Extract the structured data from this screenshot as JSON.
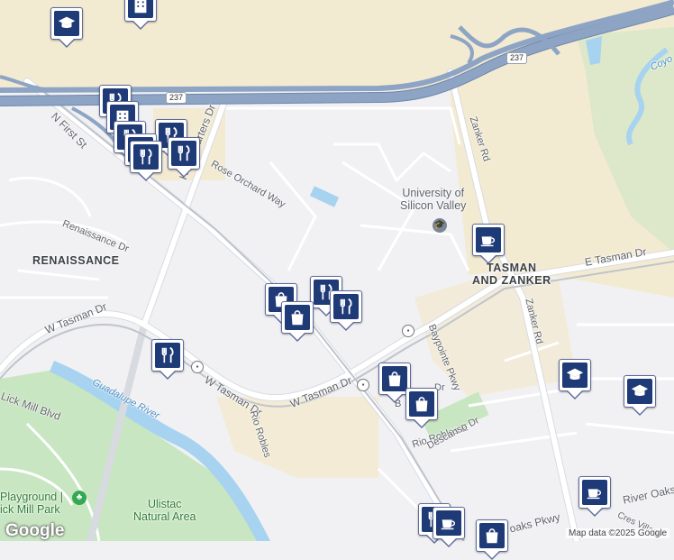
{
  "highway_shield": "237",
  "labels": {
    "north_first_st": "N First St",
    "headquarters_dr": "Headquarters Dr",
    "rose_orchard_way": "Rose Orchard Way",
    "renaissance_dr": "Renaissance Dr",
    "renaissance": "RENAISSANCE",
    "university_line1": "University of",
    "university_line2": "Silicon Valley",
    "zanker_rd_north": "Zanker Rd",
    "zanker_rd_south": "Zanker Rd",
    "e_tasman_dr": "E Tasman Dr",
    "tasman_zanker_line1": "TASMAN",
    "tasman_zanker_line2": "AND ZANKER",
    "w_tasman_dr_west": "W Tasman Dr",
    "w_tasman_dr_mid": "W Tasman Dr",
    "w_tasman_dr_east": "W Tasman Dr",
    "baypointe_pkwy": "Baypointe Pkwy",
    "rio_robles": "Rio Robles",
    "rio_robles_e": "Rio Robles E",
    "descanso_dr": "Descanso Dr",
    "b_dr": "B",
    "b_dr2": "Dr",
    "lick_mill_blvd": "Lick Mill Blvd",
    "guadalupe_river": "Guadalupe River",
    "coyote": "Coyo",
    "playground_park_line1": "Playground |",
    "playground_park_line2": "ick Mill Park",
    "ulistac_line1": "Ulistac",
    "ulistac_line2": "Natural Area",
    "river_oaks": "River Oaks",
    "cres_village": "Cres Village",
    "oaks_pkwy": "oaks Pkwy"
  },
  "pins": [
    {
      "name": "school-marker-1",
      "icon": "graduation-cap-icon"
    },
    {
      "name": "building-marker-top",
      "icon": "building-icon"
    },
    {
      "name": "restaurant-marker-1",
      "icon": "fork-knife-icon"
    },
    {
      "name": "building-marker-2",
      "icon": "building-icon"
    },
    {
      "name": "restaurant-marker-2",
      "icon": "fork-knife-icon"
    },
    {
      "name": "restaurant-marker-3",
      "icon": "fork-knife-icon"
    },
    {
      "name": "restaurant-marker-4",
      "icon": "fork-knife-icon"
    },
    {
      "name": "restaurant-marker-5",
      "icon": "fork-knife-icon"
    },
    {
      "name": "restaurant-marker-6",
      "icon": "fork-knife-icon"
    },
    {
      "name": "shopping-marker-1",
      "icon": "shopping-bag-icon"
    },
    {
      "name": "restaurant-marker-7",
      "icon": "fork-knife-icon"
    },
    {
      "name": "restaurant-marker-8",
      "icon": "fork-knife-icon"
    },
    {
      "name": "shopping-marker-2",
      "icon": "shopping-bag-icon"
    },
    {
      "name": "cafe-marker-1",
      "icon": "coffee-cup-icon"
    },
    {
      "name": "restaurant-marker-9",
      "icon": "fork-knife-icon"
    },
    {
      "name": "shopping-marker-3",
      "icon": "shopping-bag-icon"
    },
    {
      "name": "shopping-marker-4",
      "icon": "shopping-bag-icon"
    },
    {
      "name": "school-marker-2",
      "icon": "graduation-cap-icon"
    },
    {
      "name": "school-marker-3",
      "icon": "graduation-cap-icon"
    },
    {
      "name": "cafe-marker-2",
      "icon": "coffee-cup-icon"
    },
    {
      "name": "restaurant-marker-10",
      "icon": "fork-knife-icon"
    },
    {
      "name": "cafe-marker-3",
      "icon": "coffee-cup-icon"
    },
    {
      "name": "shopping-marker-5",
      "icon": "shopping-bag-icon"
    }
  ],
  "colors": {
    "pin_glyph": "#1f3b77",
    "pin_border": "#5e6b99",
    "highway": "#8da4c4",
    "park": "#c8e6c1",
    "water": "#a7d3f0",
    "commercial": "#f3ead2"
  },
  "google_logo": "Google",
  "attribution": "Map data ©2025 Google"
}
